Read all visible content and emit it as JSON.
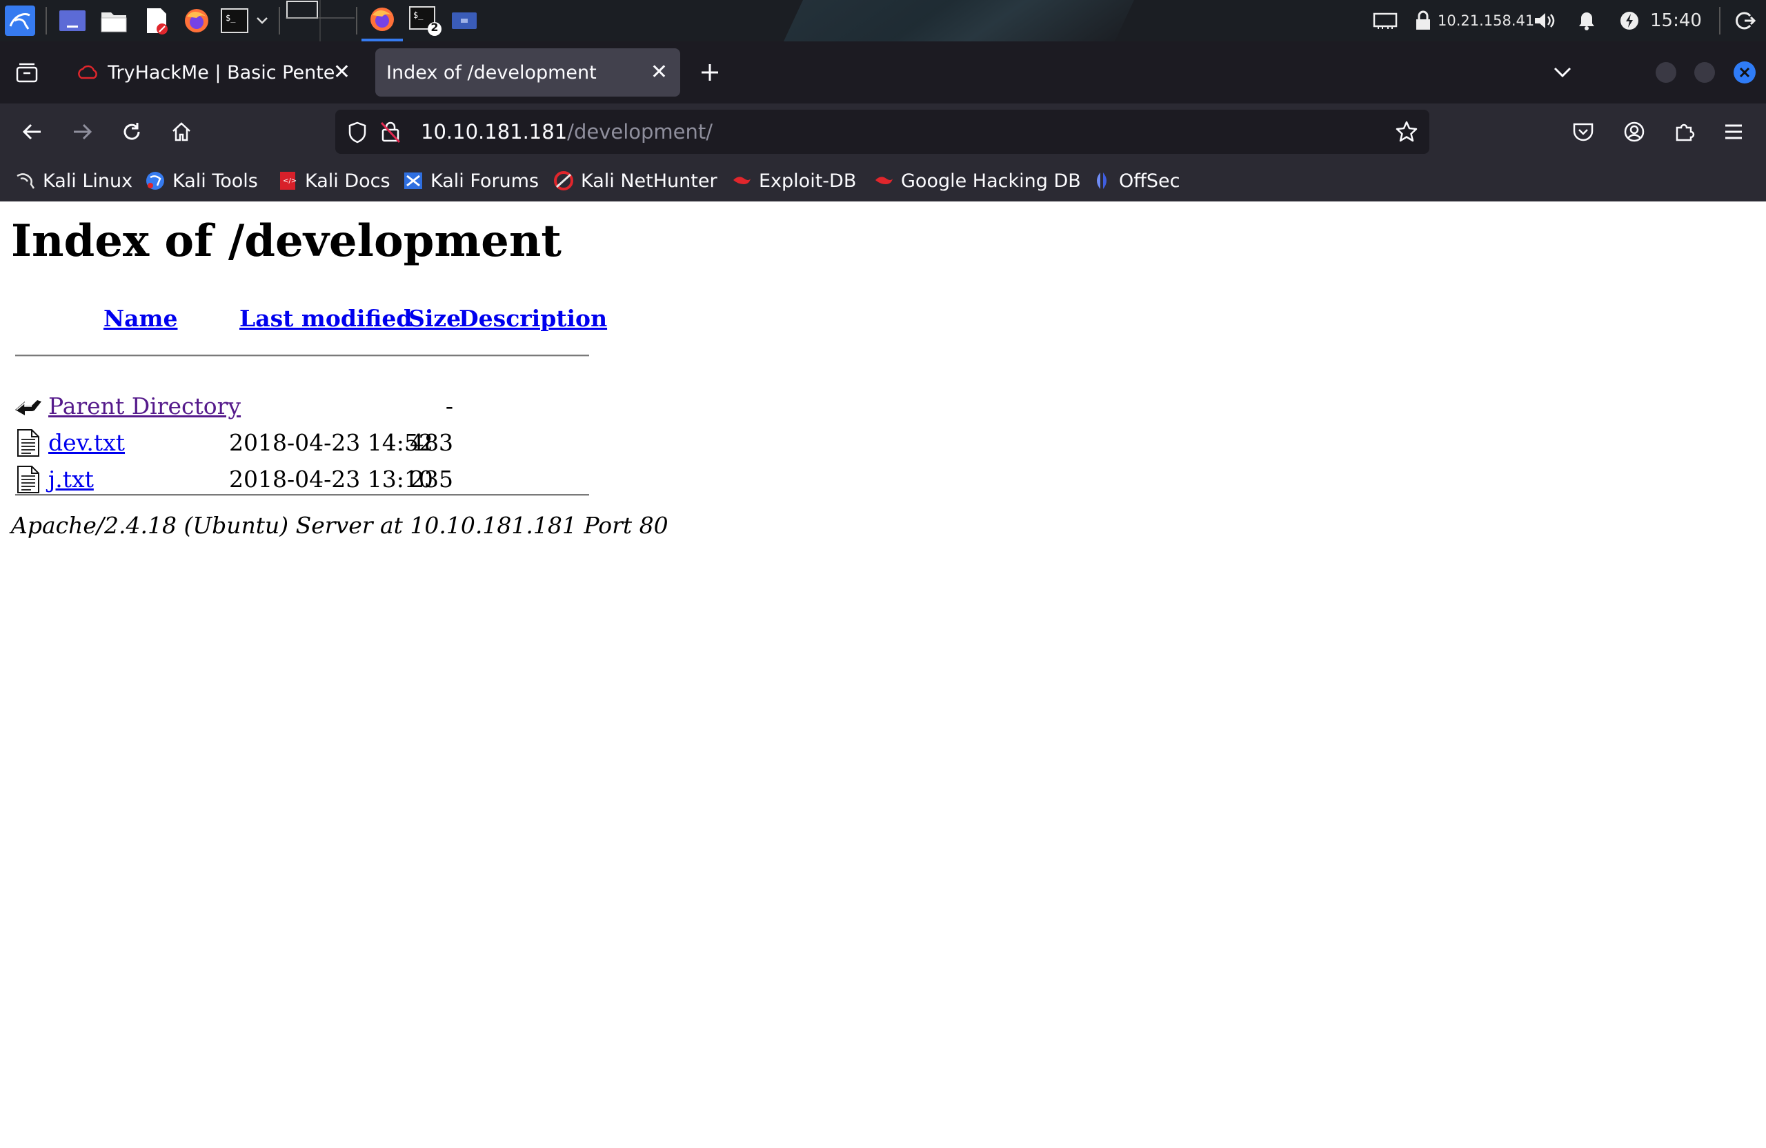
{
  "taskbar": {
    "ip": "10.21.158.41",
    "clock": "15:40",
    "terminal_badge": "2"
  },
  "tabs": [
    {
      "title": "TryHackMe | Basic Pentes",
      "active": false
    },
    {
      "title": "Index of /development",
      "active": true
    }
  ],
  "url": {
    "host": "10.10.181.181",
    "path": "/development/"
  },
  "bookmarks": [
    {
      "label": "Kali Linux",
      "icon": "kali-dragon-icon"
    },
    {
      "label": "Kali Tools",
      "icon": "kali-tools-icon"
    },
    {
      "label": "Kali Docs",
      "icon": "kali-docs-icon"
    },
    {
      "label": "Kali Forums",
      "icon": "kali-forums-icon"
    },
    {
      "label": "Kali NetHunter",
      "icon": "nethunter-icon"
    },
    {
      "label": "Exploit-DB",
      "icon": "exploit-db-icon"
    },
    {
      "label": "Google Hacking DB",
      "icon": "ghdb-icon"
    },
    {
      "label": "OffSec",
      "icon": "offsec-icon"
    }
  ],
  "page": {
    "heading": "Index of /development",
    "columns": {
      "name": "Name",
      "last_modified": "Last modified",
      "size": "Size",
      "description": "Description"
    },
    "rows": [
      {
        "name": "Parent Directory",
        "date": "",
        "size": "-",
        "icon": "back-arrow-icon",
        "visited": true
      },
      {
        "name": "dev.txt",
        "date": "2018-04-23 14:52",
        "size": "483",
        "icon": "text-file-icon",
        "visited": false
      },
      {
        "name": "j.txt",
        "date": "2018-04-23 13:10",
        "size": "235",
        "icon": "text-file-icon",
        "visited": false
      }
    ],
    "footer": "Apache/2.4.18 (Ubuntu) Server at 10.10.181.181 Port 80"
  },
  "colors": {
    "link": "#0000ee",
    "visited": "#551a8b",
    "chrome_dark": "#1c1b22",
    "chrome": "#2b2a33"
  }
}
